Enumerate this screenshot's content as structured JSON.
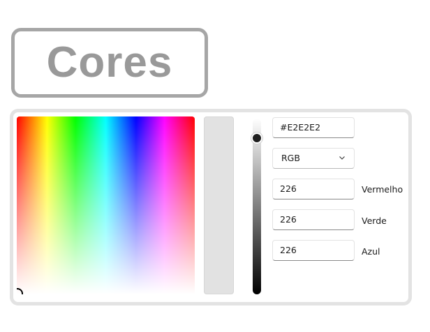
{
  "header": {
    "title": "Cores"
  },
  "color_picker": {
    "selected_color": "#E2E2E2",
    "hex_value": "#E2E2E2",
    "mode": "RGB",
    "brightness_level": 0.11,
    "channels": [
      {
        "label": "Vermelho",
        "value": "226"
      },
      {
        "label": "Verde",
        "value": "226"
      },
      {
        "label": "Azul",
        "value": "226"
      }
    ]
  },
  "icons": {
    "mode_dropdown": "chevron-down-icon"
  },
  "colors": {
    "title_border": "#a6a6a6",
    "title_text": "#999999",
    "panel_border": "#e3e3e3",
    "preview": "#e2e2e2"
  }
}
